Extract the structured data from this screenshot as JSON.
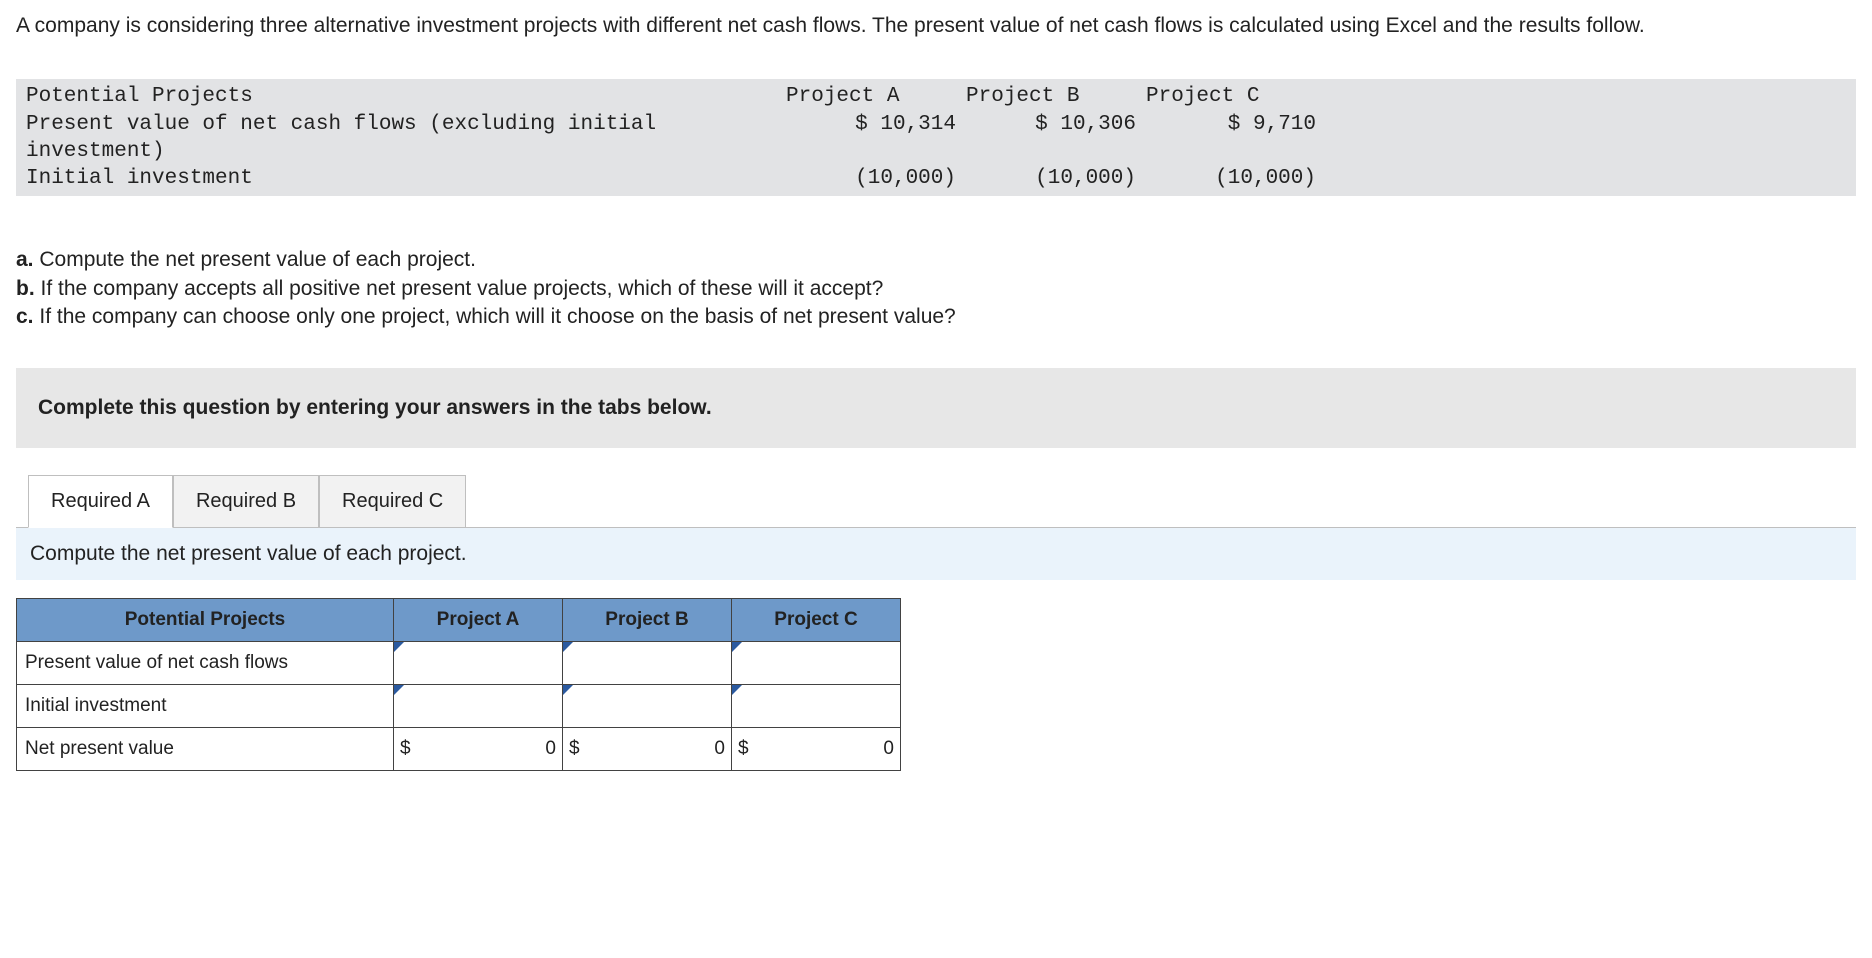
{
  "intro": "A company is considering three alternative investment projects with different net cash flows. The present value of net cash flows is calculated using Excel and the results follow.",
  "mono": {
    "header_label": "Potential Projects",
    "pv_label": "Present value of net cash flows (excluding initial investment)",
    "init_label": "Initial investment",
    "cols": [
      "Project A",
      "Project B",
      "Project C"
    ],
    "pv": [
      "$ 10,314",
      "$ 10,306",
      "$ 9,710"
    ],
    "init": [
      "(10,000)",
      "(10,000)",
      "(10,000)"
    ]
  },
  "questions": {
    "a": "Compute the net present value of each project.",
    "b": "If the company accepts all positive net present value projects, which of these will it accept?",
    "c": "If the company can choose only one project, which will it choose on the basis of net present value?"
  },
  "prompt": "Complete this question by entering your answers in the tabs below.",
  "tabs": [
    "Required A",
    "Required B",
    "Required C"
  ],
  "subprompt": "Compute the net present value of each project.",
  "table": {
    "headers": [
      "Potential Projects",
      "Project A",
      "Project B",
      "Project C"
    ],
    "row1": "Present value of net cash flows",
    "row2": "Initial investment",
    "row3": "Net present value",
    "npv_dollar": "$",
    "npv_val": "0"
  }
}
